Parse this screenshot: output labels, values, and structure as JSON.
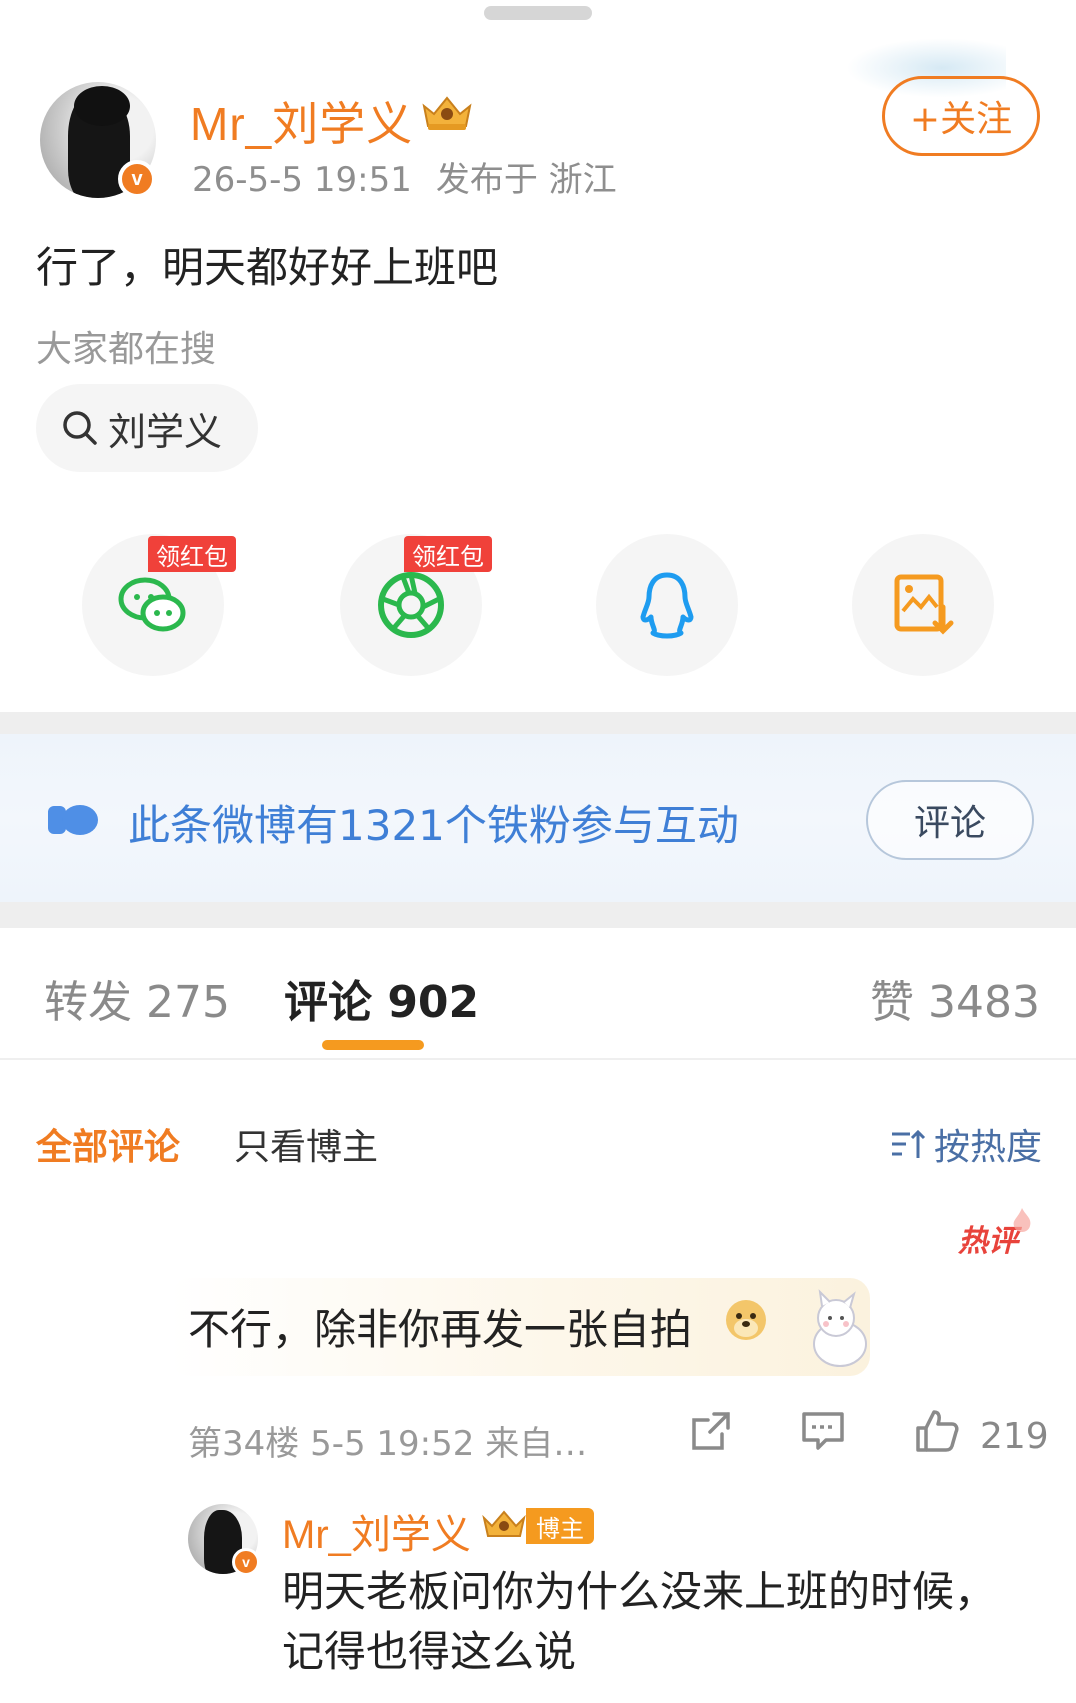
{
  "post": {
    "author": "Mr_刘学义",
    "time": "26-5-5 19:51",
    "location": "发布于 浙江",
    "follow_label": "+关注",
    "content": "行了，明天都好好上班吧",
    "search_hint": "大家都在搜",
    "search_chip": "刘学义"
  },
  "share": {
    "redpack_label": "领红包",
    "items": [
      "wechat-icon",
      "moments-icon",
      "qq-icon",
      "save-image-icon"
    ]
  },
  "fan_banner": {
    "text": "此条微博有1321个铁粉参与互动",
    "button": "评论",
    "accent": "#3f7fd6"
  },
  "tabs": {
    "repost": "转发 275",
    "comment": "评论 902",
    "like": "赞 3483"
  },
  "filters": {
    "all": "全部评论",
    "author_only": "只看博主",
    "sort": "按热度"
  },
  "comment": {
    "hot_tag": "热评",
    "text": "不行，除非你再发一张自拍",
    "meta": "第34楼 5-5 19:52 来自…",
    "likes": "219"
  },
  "reply": {
    "author": "Mr_刘学义",
    "tag": "博主",
    "text": "明天老板问你为什么没来上班的时候，记得也得这么说"
  },
  "colors": {
    "brand_orange": "#f07c22",
    "red": "#f0413a",
    "wechat_green": "#2bb84d",
    "qq_blue": "#1e9cf0"
  }
}
